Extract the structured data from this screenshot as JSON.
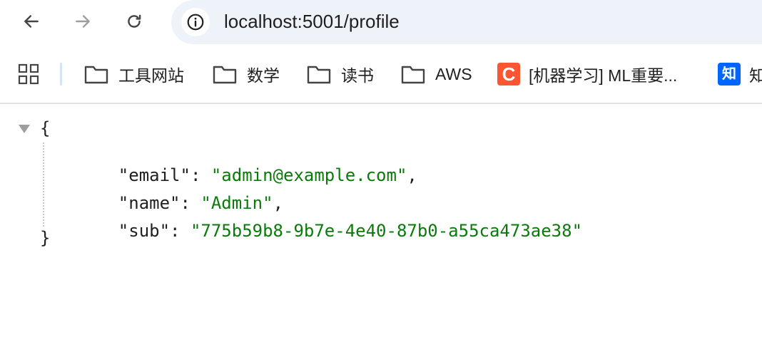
{
  "toolbar": {
    "url": "localhost:5001/profile",
    "icons": {
      "back": "arrow-left-icon",
      "forward": "arrow-right-icon",
      "reload": "reload-icon",
      "site_info": "info-icon"
    },
    "colors": {
      "omnibox_bg": "#eef2f9",
      "forward_disabled": "#9e9e9e"
    }
  },
  "bookmarks": {
    "apps_icon": "apps-grid-icon",
    "items": [
      {
        "label": "工具网站",
        "icon": "folder-icon"
      },
      {
        "label": "数学",
        "icon": "folder-icon"
      },
      {
        "label": "读书",
        "icon": "folder-icon"
      },
      {
        "label": "AWS",
        "icon": "folder-icon"
      },
      {
        "label": "[机器学习] ML重要...",
        "icon": "csdn-icon",
        "icon_glyph": "C",
        "icon_color": "#fc5531"
      },
      {
        "label": "知",
        "icon": "zhihu-icon",
        "icon_glyph": "知",
        "icon_color": "#0066ff"
      }
    ]
  },
  "json_view": {
    "open_brace": "{",
    "close_brace": "}",
    "entries": [
      {
        "key": "\"email\"",
        "sep": ": ",
        "value": "\"admin@example.com\"",
        "trail": ","
      },
      {
        "key": "\"name\"",
        "sep": ": ",
        "value": "\"Admin\"",
        "trail": ","
      },
      {
        "key": "\"sub\"",
        "sep": ": ",
        "value": "\"775b59b8-9b7e-4e40-87b0-a55ca473ae38\"",
        "trail": ""
      }
    ],
    "colors": {
      "string": "#0a7a0a",
      "key": "#1f1f1f"
    }
  }
}
